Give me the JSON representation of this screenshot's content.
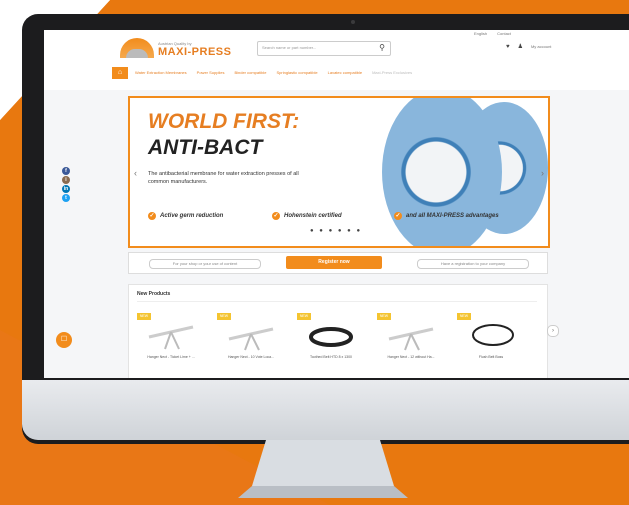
{
  "colors": {
    "accent": "#f28c1c",
    "accent_dark": "#e67e22",
    "roll_blue": "#89b6dc"
  },
  "header": {
    "logo_tagline": "Austrian Quality by",
    "logo_name": "MAXI-PRESS",
    "search_placeholder": "Search name or part number...",
    "search_icon": "magnifier-icon",
    "top_links": [
      "English",
      "Contact"
    ],
    "cart_icon": "heart-icon",
    "account_icon": "user-icon",
    "account_label": "My account"
  },
  "nav": {
    "home_icon": "home-icon",
    "items": [
      "Water Extraction Membranes",
      "Power Supplies",
      "Binder compatible",
      "Springlastic compatible",
      "Lavatec compatible",
      "Maxi-Press Exclusives"
    ]
  },
  "hero": {
    "title_line1": "WORLD FIRST:",
    "title_line2": "ANTI-BACT",
    "description": "The antibacterial membrane for water extraction presses of all common manufacturers.",
    "features": [
      "Active germ reduction",
      "Hohenstein certified",
      "and all MAXI-PRESS advantages"
    ],
    "dots": "● ● ● ● ● ●",
    "prev_arrow": "‹",
    "next_arrow": "›"
  },
  "register": {
    "left_pill": "For your shop or your use of content",
    "button": "Register now",
    "right_pill": "Have a registration to your company"
  },
  "products": {
    "title": "New Products",
    "next_arrow": "›",
    "items": [
      {
        "badge": "NEW",
        "label": "Hanger Nect - Ticket Lime + ...",
        "kind": "hanger"
      },
      {
        "badge": "NEW",
        "label": "Hanger Nect - 10 Vote Loca...",
        "kind": "hanger"
      },
      {
        "badge": "NEW",
        "label": "Toothed Belt HTD 8 x 1300",
        "kind": "belt-dark"
      },
      {
        "badge": "NEW",
        "label": "Hanger Nect - 12 without Ha...",
        "kind": "hanger"
      },
      {
        "badge": "NEW",
        "label": "Flush Belt Boss",
        "kind": "belt-ring"
      }
    ]
  },
  "social": {
    "items": [
      "f",
      "i",
      "in",
      "t"
    ],
    "colors": [
      "#3b5998",
      "#8a6b4f",
      "#0077b5",
      "#1da1f2"
    ]
  },
  "chat": {
    "icon": "chat-icon",
    "glyph": "☐"
  }
}
